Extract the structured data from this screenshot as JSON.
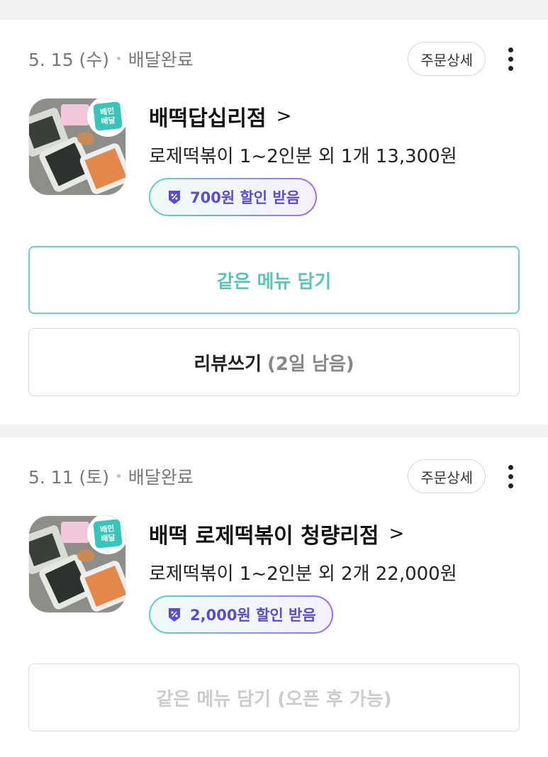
{
  "orders": [
    {
      "date": "5. 15 (수)",
      "status": "배달완료",
      "detail_label": "주문상세",
      "store_name": "배떡답십리점",
      "summary": "로제떡볶이 1~2인분 외 1개 13,300원",
      "coupon": "700원 할인 받음",
      "badge_line1": "배민",
      "badge_line2": "배달",
      "reorder_label": "같은 메뉴 담기",
      "review_label": "리뷰쓰기",
      "review_sub": "(2일 남음)"
    },
    {
      "date": "5. 11 (토)",
      "status": "배달완료",
      "detail_label": "주문상세",
      "store_name": "배떡 로제떡볶이 청량리점",
      "summary": "로제떡볶이 1~2인분 외 2개 22,000원",
      "coupon": "2,000원 할인 받음",
      "badge_line1": "배민",
      "badge_line2": "배달",
      "reorder_label": "같은 메뉴 담기 (오픈 후 가능)"
    }
  ],
  "icons": {
    "chevron": "chevron-right-icon",
    "more": "more-vertical-icon",
    "coupon": "coupon-icon"
  },
  "colors": {
    "accent": "#5cc4b6",
    "coupon_text": "#5b4ccf"
  }
}
